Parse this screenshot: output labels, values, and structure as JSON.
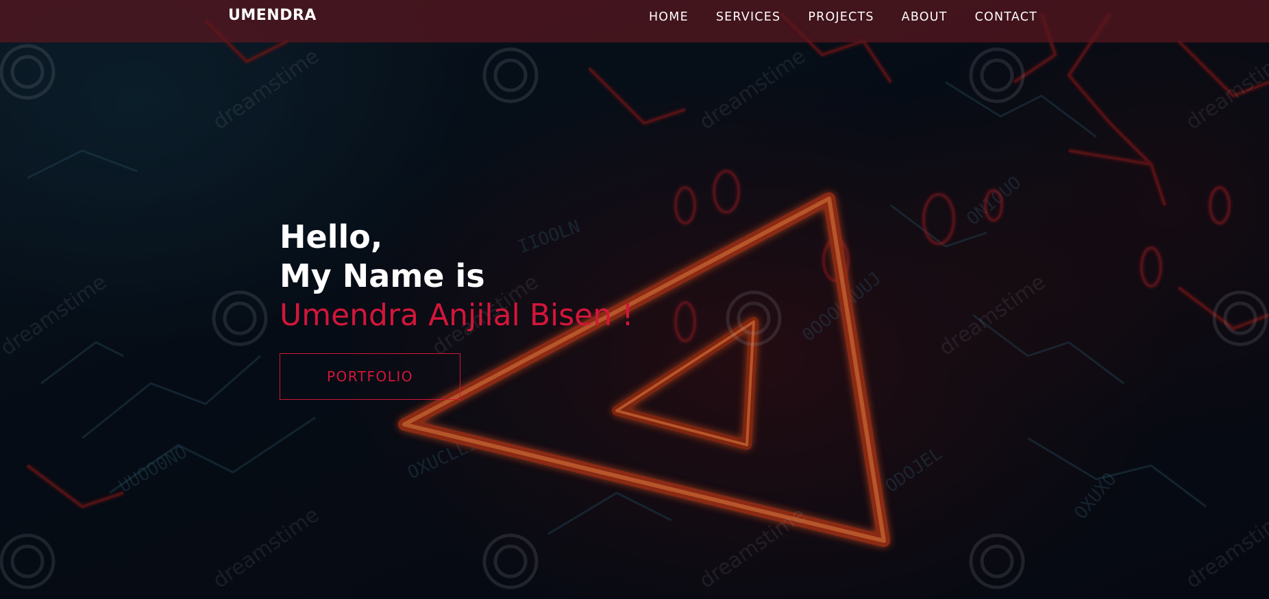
{
  "header": {
    "brand": "UMENDRA",
    "nav": [
      {
        "label": "HOME"
      },
      {
        "label": "SERVICES"
      },
      {
        "label": "PROJECTS"
      },
      {
        "label": "ABOUT"
      },
      {
        "label": "CONTACT"
      }
    ]
  },
  "hero": {
    "line1": "Hello,",
    "line2": "My Name is",
    "name": "Umendra Anjilal Bisen !",
    "button_label": "PORTFOLIO"
  },
  "colors": {
    "accent": "#d3163a",
    "navbar": "#5a161e",
    "background": "#07101c"
  },
  "background_image": {
    "description_icon": "circuit-warning-triangle-image",
    "watermark": "dreamstime"
  }
}
